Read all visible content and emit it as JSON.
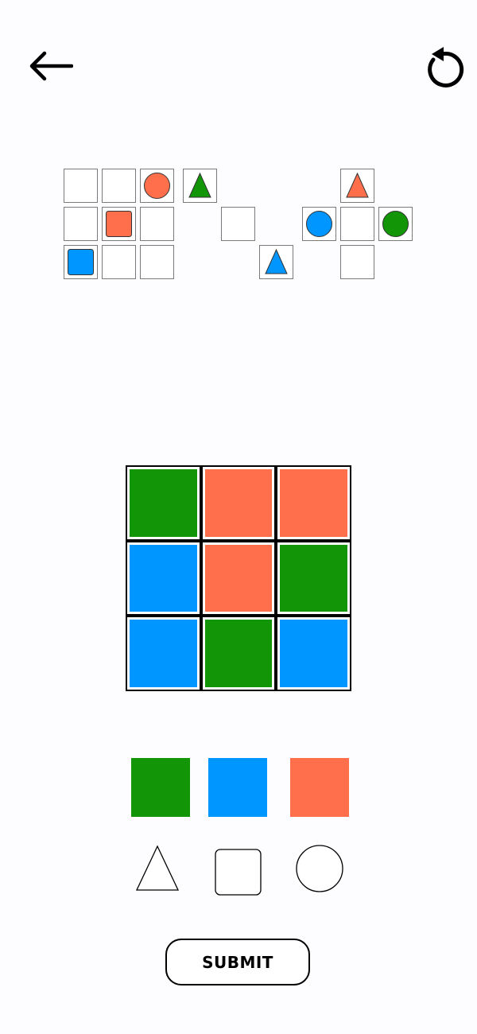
{
  "header": {
    "back_icon": "arrow-left-icon",
    "reset_icon": "rotate-ccw-icon"
  },
  "colors": {
    "green": "#129608",
    "blue": "#0096ff",
    "orange": "#ff6f4b",
    "stroke": "#000000"
  },
  "clues": [
    {
      "id": "a1",
      "shape": "none",
      "color": ""
    },
    {
      "id": "a2",
      "shape": "none",
      "color": ""
    },
    {
      "id": "a3",
      "shape": "circle",
      "color": "orange"
    },
    {
      "id": "a4",
      "shape": "none",
      "color": ""
    },
    {
      "id": "a5",
      "shape": "square",
      "color": "orange"
    },
    {
      "id": "a6",
      "shape": "none",
      "color": ""
    },
    {
      "id": "a7",
      "shape": "square",
      "color": "blue"
    },
    {
      "id": "a8",
      "shape": "none",
      "color": ""
    },
    {
      "id": "a9",
      "shape": "none",
      "color": ""
    },
    {
      "id": "b1",
      "shape": "triangle",
      "color": "green"
    },
    {
      "id": "c1",
      "shape": "none",
      "color": ""
    },
    {
      "id": "d1",
      "shape": "triangle",
      "color": "blue"
    },
    {
      "id": "e1",
      "shape": "triangle",
      "color": "orange"
    },
    {
      "id": "e2",
      "shape": "circle",
      "color": "blue"
    },
    {
      "id": "e3",
      "shape": "none",
      "color": ""
    },
    {
      "id": "e4",
      "shape": "circle",
      "color": "green"
    },
    {
      "id": "e5",
      "shape": "none",
      "color": ""
    }
  ],
  "board": [
    [
      "green",
      "orange",
      "orange"
    ],
    [
      "blue",
      "orange",
      "green"
    ],
    [
      "blue",
      "green",
      "blue"
    ]
  ],
  "palette": {
    "colors": [
      "green",
      "blue",
      "orange"
    ],
    "shapes": [
      "triangle",
      "square",
      "circle"
    ]
  },
  "submit_label": "SUBMIT"
}
